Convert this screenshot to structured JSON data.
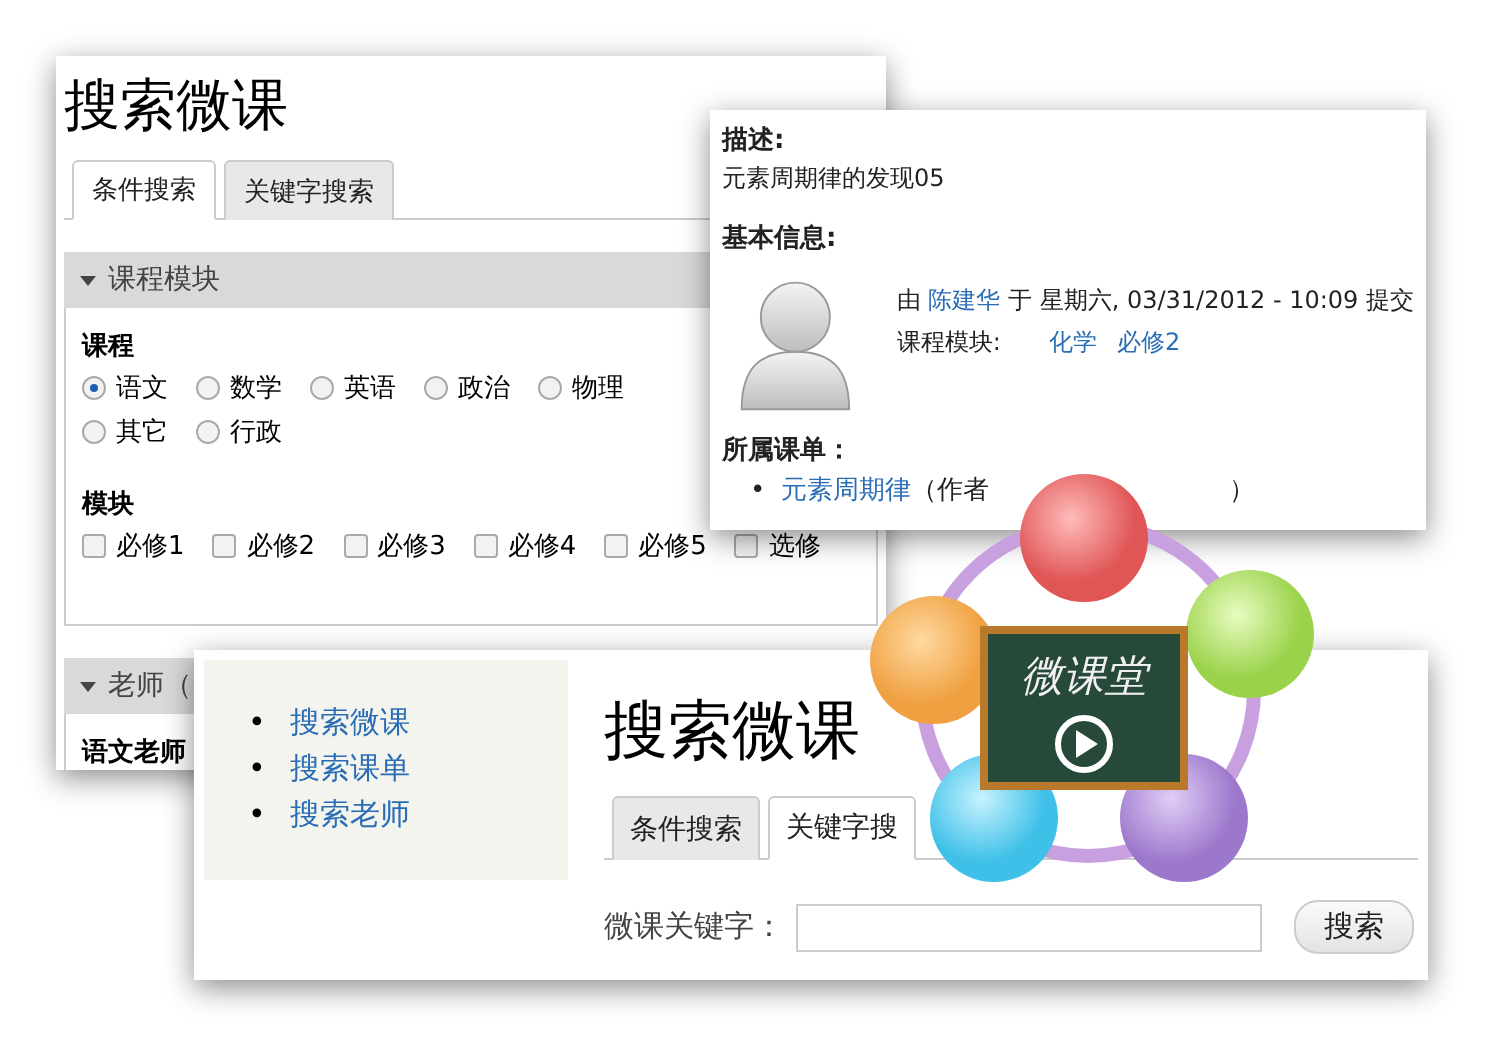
{
  "search_window": {
    "title": "搜索微课",
    "tabs": [
      {
        "label": "条件搜索",
        "selected": true
      },
      {
        "label": "关键字搜索",
        "selected": false
      }
    ],
    "sections": [
      {
        "title": "课程模块",
        "expanded": true,
        "groups": [
          {
            "label": "课程",
            "kind": "radio",
            "options": [
              {
                "label": "语文",
                "selected": true
              },
              {
                "label": "数学",
                "selected": false
              },
              {
                "label": "英语",
                "selected": false
              },
              {
                "label": "政治",
                "selected": false
              },
              {
                "label": "物理",
                "selected": false
              },
              {
                "label": "其它",
                "selected": false
              },
              {
                "label": "行政",
                "selected": false
              }
            ]
          },
          {
            "label": "模块",
            "kind": "checkbox",
            "options": [
              {
                "label": "必修1",
                "checked": false
              },
              {
                "label": "必修2",
                "checked": false
              },
              {
                "label": "必修3",
                "checked": false
              },
              {
                "label": "必修4",
                "checked": false
              },
              {
                "label": "必修5",
                "checked": false
              },
              {
                "label": "选修",
                "checked": false
              }
            ]
          }
        ]
      },
      {
        "title": "老师（",
        "expanded": true,
        "groups": [
          {
            "label": "语文老师",
            "kind": "label"
          }
        ]
      }
    ]
  },
  "info_window": {
    "description_label": "描述:",
    "description": "元素周期律的发现05",
    "basic_info_label": "基本信息:",
    "by_prefix": "由",
    "author": "陈建华",
    "submitted_text": "于 星期六, 03/31/2012 - 10:09 提交",
    "module_label": "课程模块:",
    "modules": [
      "化学",
      "必修2"
    ],
    "playlist_label": "所属课单：",
    "playlists": [
      {
        "bullet": "•",
        "title": "元素周期律",
        "note": "（作者",
        "note_end": "）"
      }
    ]
  },
  "front_window": {
    "sidebar": [
      {
        "bullet": "•",
        "label": "搜索微课"
      },
      {
        "bullet": "•",
        "label": "搜索课单"
      },
      {
        "bullet": "•",
        "label": "搜索老师"
      }
    ],
    "title": "搜索微课",
    "tabs": [
      {
        "label": "条件搜索",
        "selected": false
      },
      {
        "label": "关键字搜",
        "selected": true
      }
    ],
    "field_label": "微课关键字：",
    "button": "搜索"
  },
  "logo": {
    "text": "微课堂"
  }
}
